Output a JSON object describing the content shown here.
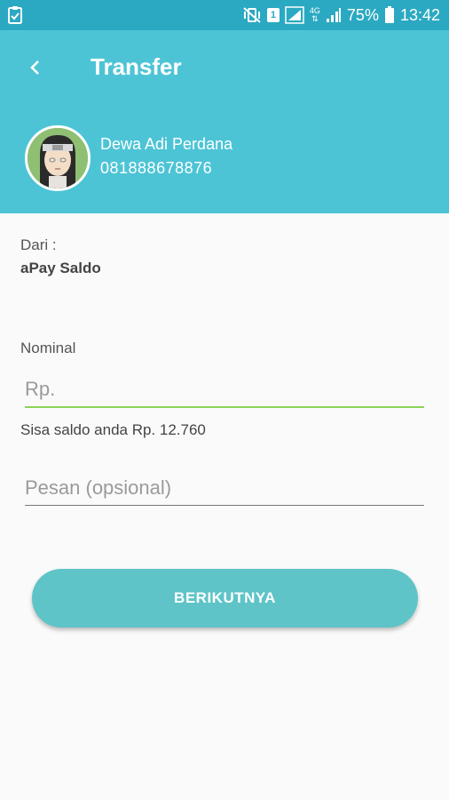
{
  "status_bar": {
    "battery": "75%",
    "time": "13:42",
    "sim_slot": "1",
    "network_type": "4G"
  },
  "header": {
    "title": "Transfer",
    "recipient": {
      "name": "Dewa Adi Perdana",
      "phone": "081888678876"
    }
  },
  "form": {
    "from_label": "Dari :",
    "from_account": "aPay Saldo",
    "nominal_label": "Nominal",
    "amount_placeholder": "Rp.",
    "balance_text": "Sisa saldo anda Rp. 12.760",
    "message_placeholder": "Pesan (opsional)",
    "next_button": "BERIKUTNYA"
  },
  "colors": {
    "status_bar": "#2ba9c2",
    "header": "#4dc4d6",
    "button": "#5ec4c8",
    "active_underline": "#8bd45a"
  }
}
